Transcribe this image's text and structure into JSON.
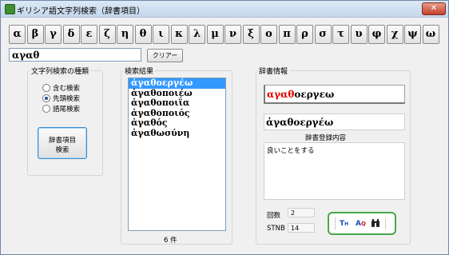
{
  "window": {
    "title": "ギリシア語文字列検索（辞書項目）",
    "close_label": "✕"
  },
  "greek_keys": [
    "α",
    "β",
    "γ",
    "δ",
    "ε",
    "ζ",
    "η",
    "θ",
    "ι",
    "κ",
    "λ",
    "μ",
    "ν",
    "ξ",
    "ο",
    "π",
    "ρ",
    "σ",
    "τ",
    "υ",
    "φ",
    "χ",
    "ψ",
    "ω"
  ],
  "search": {
    "value": "αγαθ",
    "clear_label": "クリアー"
  },
  "search_type": {
    "label": "文字列検索の種類",
    "options": [
      {
        "label": "含む検索",
        "checked": false
      },
      {
        "label": "先頭検索",
        "checked": true
      },
      {
        "label": "語尾検索",
        "checked": false
      }
    ],
    "button_line1": "辞書項目",
    "button_line2": "検索"
  },
  "results": {
    "label": "検索結果",
    "items": [
      "ἀγαθοεργέω",
      "ἀγαθοποιέω",
      "ἀγαθοποιΐα",
      "ἀγαθοποιός",
      "ἀγαθός",
      "ἀγαθωσύνη"
    ],
    "selected_index": 0,
    "count_text": "6 件"
  },
  "dictionary": {
    "label": "辞書情報",
    "headword_match": "αγαθ",
    "headword_rest": "οεργεω",
    "form": "ἀγαθοεργέω",
    "content_label": "辞書登録内容",
    "content": "良いことをする",
    "count_label": "回数",
    "count_value": "2",
    "stnb_label": "STNB",
    "stnb_value": "14"
  },
  "colors": {
    "accent_red": "#e00000",
    "selection": "#3399ff",
    "toolbar_border": "#4aa64a"
  },
  "toolbar_icons": [
    "th-icon",
    "aq-icon",
    "binoculars-icon"
  ]
}
